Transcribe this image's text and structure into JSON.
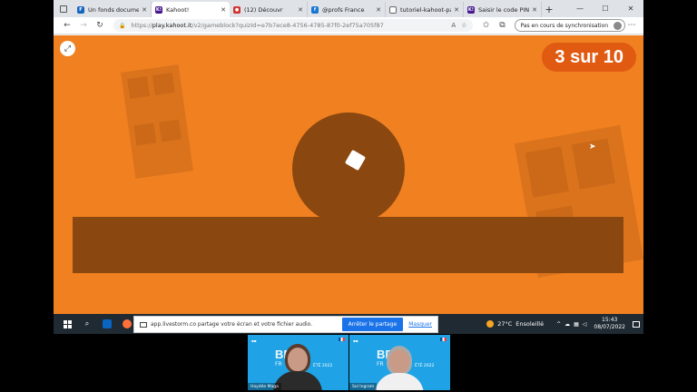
{
  "browser": {
    "tabs": [
      {
        "label": "Un fonds documen",
        "color": "#1565c0",
        "glyph": "F",
        "active": false
      },
      {
        "label": "Kahoot!",
        "color": "#46178f",
        "glyph": "K!",
        "active": true
      },
      {
        "label": "(12) Découvr",
        "color": "#d32f2f",
        "glyph": "●",
        "active": false
      },
      {
        "label": "@profs France",
        "color": "#1976d2",
        "glyph": "f",
        "active": false
      },
      {
        "label": "tutoriel-kahoot-pa",
        "color": "#ffffff",
        "glyph": "",
        "active": false
      },
      {
        "label": "Saisir le code PIN",
        "color": "#46178f",
        "glyph": "K!",
        "active": false
      }
    ],
    "new_tab": "+",
    "url_prefix": "https://",
    "url_host": "play.kahoot.it",
    "url_path": "/v2/gameblock?quizId=e7b7ece8-4756-4785-87f0-2ef75a705f87",
    "sync_label": "Pas en cours de synchronisation"
  },
  "game": {
    "counter": "3 sur 10",
    "colors": {
      "background": "#f08020",
      "shape": "#8a4710",
      "counter_bg": "#e05a12"
    }
  },
  "share_bar": {
    "message": "app.livestorm.co partage votre écran et votre fichier audio.",
    "stop_label": "Arrêter le partage",
    "hide_label": "Masquer"
  },
  "taskbar": {
    "weather_temp": "27°C",
    "weather_text": "Ensoleillé",
    "time": "15:43",
    "date": "08/07/2022"
  },
  "webcams": [
    {
      "name": "Haydée Maga",
      "brand": "BP",
      "brand_line2": "FR",
      "edition": "ÉTÉ 2022"
    },
    {
      "name": "Sol Ingram",
      "brand": "BP",
      "brand_line2": "FR",
      "edition": "ÉTÉ 2022"
    }
  ]
}
